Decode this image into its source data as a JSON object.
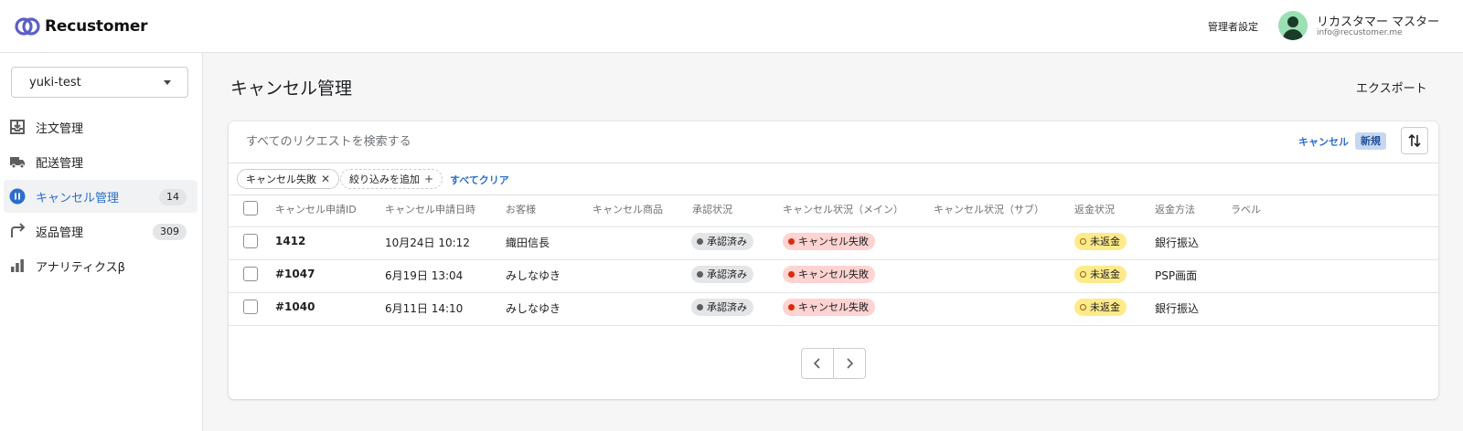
{
  "header": {
    "brand": "Recustomer",
    "admin_settings": "管理者設定",
    "user_name": "リカスタマー マスター",
    "user_email": "info@recustomer.me",
    "accent_color": "#5b5fc7"
  },
  "sidebar": {
    "store": "yuki-test",
    "items": [
      {
        "label": "注文管理",
        "icon": "inbox-download-icon"
      },
      {
        "label": "配送管理",
        "icon": "truck-icon"
      },
      {
        "label": "キャンセル管理",
        "icon": "pause-circle-icon",
        "badge": "14",
        "active": true
      },
      {
        "label": "返品管理",
        "icon": "return-arrow-icon",
        "badge": "309"
      },
      {
        "label": "アナリティクスβ",
        "icon": "bar-chart-icon"
      }
    ]
  },
  "main": {
    "title": "キャンセル管理",
    "export_label": "エクスポート",
    "search_placeholder": "すべてのリクエストを検索する",
    "tabs": {
      "cancel": "キャンセル",
      "new": "新規"
    },
    "filters": {
      "chip_active": "キャンセル失敗",
      "chip_add": "絞り込みを追加",
      "clear_all": "すべてクリア"
    },
    "columns": [
      "キャンセル申請ID",
      "キャンセル申請日時",
      "お客様",
      "キャンセル商品",
      "承認状況",
      "キャンセル状況（メイン）",
      "キャンセル状況（サブ）",
      "返金状況",
      "返金方法",
      "ラベル"
    ],
    "rows": [
      {
        "id": "1412",
        "date": "10月24日 10:12",
        "customer": "織田信長",
        "approval": "承認済み",
        "status_main": "キャンセル失敗",
        "refund_status": "未返金",
        "refund_method": "銀行振込"
      },
      {
        "id": "#1047",
        "date": "6月19日 13:04",
        "customer": "みしなゆき",
        "approval": "承認済み",
        "status_main": "キャンセル失敗",
        "refund_status": "未返金",
        "refund_method": "PSP画面"
      },
      {
        "id": "#1040",
        "date": "6月11日 14:10",
        "customer": "みしなゆき",
        "approval": "承認済み",
        "status_main": "キャンセル失敗",
        "refund_status": "未返金",
        "refund_method": "銀行振込"
      }
    ],
    "colors": {
      "link_blue": "#2c6ecb",
      "badge_red": "#fed3d1",
      "badge_yellow": "#ffea8a",
      "badge_gray": "#e4e5e7"
    }
  }
}
